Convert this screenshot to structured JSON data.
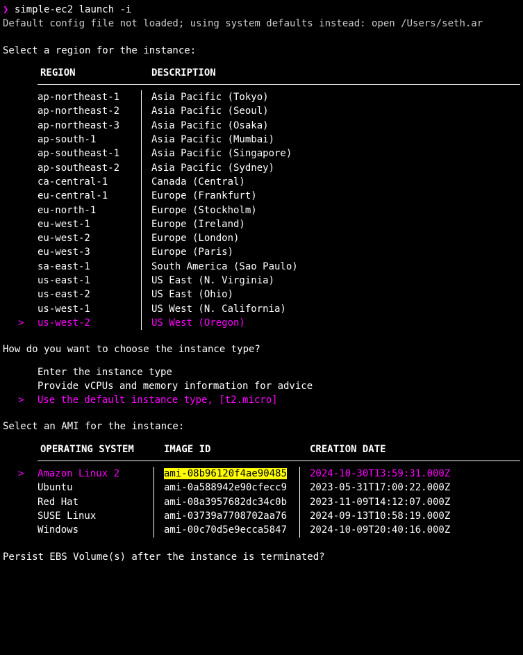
{
  "prompt": {
    "char": "❯",
    "command": "simple-ec2 launch -i"
  },
  "warning": "Default config file not loaded; using system defaults instead: open /Users/seth.ar",
  "region_section": {
    "title": "Select a region for the instance:",
    "headers": {
      "region": "REGION",
      "description": "DESCRIPTION"
    },
    "rows": [
      {
        "region": "ap-northeast-1",
        "desc": "Asia Pacific (Tokyo)"
      },
      {
        "region": "ap-northeast-2",
        "desc": "Asia Pacific (Seoul)"
      },
      {
        "region": "ap-northeast-3",
        "desc": "Asia Pacific (Osaka)"
      },
      {
        "region": "ap-south-1",
        "desc": "Asia Pacific (Mumbai)"
      },
      {
        "region": "ap-southeast-1",
        "desc": "Asia Pacific (Singapore)"
      },
      {
        "region": "ap-southeast-2",
        "desc": "Asia Pacific (Sydney)"
      },
      {
        "region": "ca-central-1",
        "desc": "Canada (Central)"
      },
      {
        "region": "eu-central-1",
        "desc": "Europe (Frankfurt)"
      },
      {
        "region": "eu-north-1",
        "desc": "Europe (Stockholm)"
      },
      {
        "region": "eu-west-1",
        "desc": "Europe (Ireland)"
      },
      {
        "region": "eu-west-2",
        "desc": "Europe (London)"
      },
      {
        "region": "eu-west-3",
        "desc": "Europe (Paris)"
      },
      {
        "region": "sa-east-1",
        "desc": "South America (Sao Paulo)"
      },
      {
        "region": "us-east-1",
        "desc": "US East (N. Virginia)"
      },
      {
        "region": "us-east-2",
        "desc": "US East (Ohio)"
      },
      {
        "region": "us-west-1",
        "desc": "US West (N. California)"
      },
      {
        "region": "us-west-2",
        "desc": "US West (Oregon)"
      }
    ],
    "selected_index": 16
  },
  "instance_type_section": {
    "question": "How do you want to choose the instance type?",
    "options": [
      "Enter the instance type",
      "Provide vCPUs and memory information for advice",
      "Use the default instance type, [t2.micro]"
    ],
    "selected_index": 2
  },
  "ami_section": {
    "title": "Select an AMI for the instance:",
    "headers": {
      "os": "OPERATING SYSTEM",
      "image_id": "IMAGE ID",
      "creation_date": "CREATION DATE"
    },
    "rows": [
      {
        "os": "Amazon Linux 2",
        "image_id": "ami-08b96120f4ae90485",
        "date": "2024-10-30T13:59:31.000Z"
      },
      {
        "os": "Ubuntu",
        "image_id": "ami-0a588942e90cfecc9",
        "date": "2023-05-31T17:00:22.000Z"
      },
      {
        "os": "Red Hat",
        "image_id": "ami-08a3957682dc34c0b",
        "date": "2023-11-09T14:12:07.000Z"
      },
      {
        "os": "SUSE Linux",
        "image_id": "ami-03739a7708702aa76",
        "date": "2024-09-13T10:58:19.000Z"
      },
      {
        "os": "Windows",
        "image_id": "ami-00c70d5e9ecca5847",
        "date": "2024-10-09T20:40:16.000Z"
      }
    ],
    "selected_index": 0
  },
  "persist_question": "Persist EBS Volume(s) after the instance is terminated?",
  "caret": ">"
}
